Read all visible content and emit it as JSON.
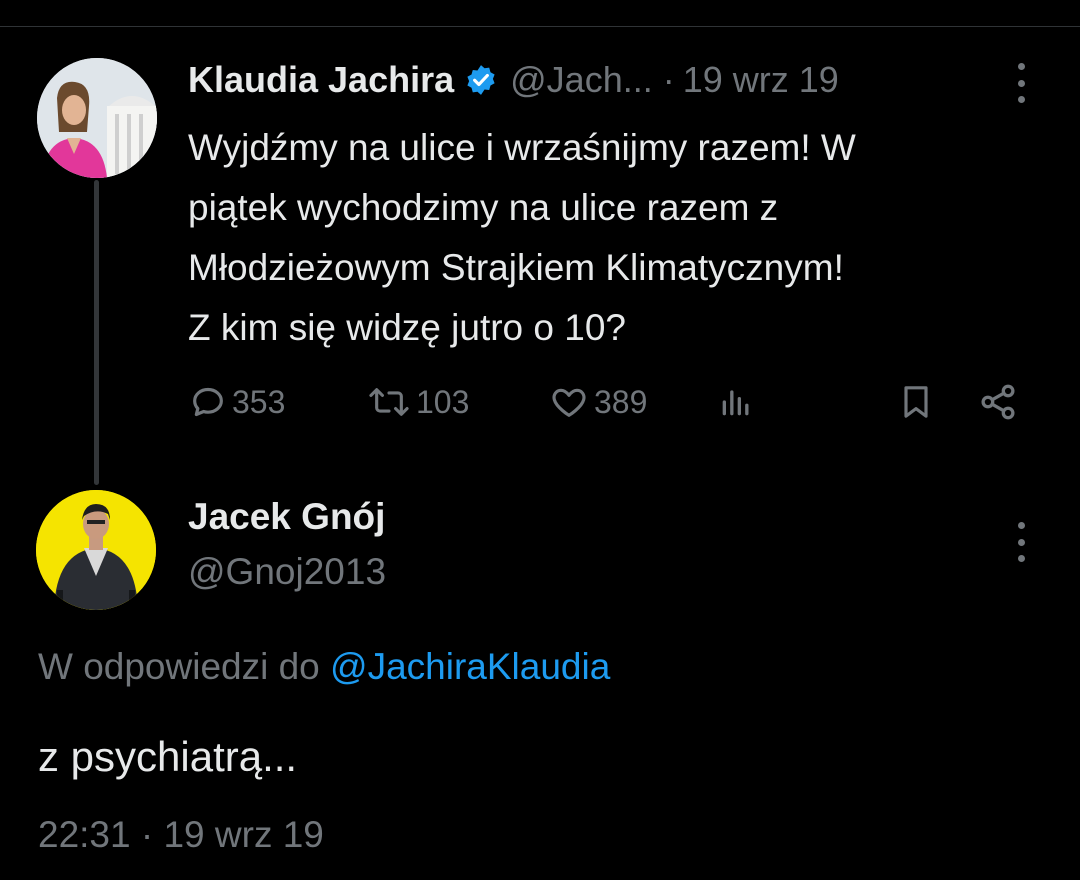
{
  "parent_tweet": {
    "author_name": "Klaudia Jachira",
    "author_handle": "@Jach...",
    "separator": "·",
    "date": "19 wrz 19",
    "text": "Wyjdźmy na ulice i wrzaśnijmy razem! W\npiątek wychodzimy na ulice razem z\nMłodzieżowym Strajkiem Klimatycznym!\nZ kim się widzę jutro o 10?",
    "icons": [
      "verified-badge-icon",
      "more-icon",
      "reply-icon",
      "retweet-icon",
      "like-icon",
      "views-icon",
      "bookmark-icon",
      "share-icon"
    ],
    "stats": {
      "replies": "353",
      "retweets": "103",
      "likes": "389"
    }
  },
  "reply_tweet": {
    "author_name": "Jacek Gnój",
    "author_handle": "@Gnoj2013",
    "reply_prefix": "W odpowiedzi do",
    "reply_mention": "@JachiraKlaudia",
    "text": "z psychiatrą...",
    "timestamp": "22:31 · 19 wrz 19"
  },
  "colors": {
    "background": "#000000",
    "text_primary": "#e7e9ea",
    "text_secondary": "#71767b",
    "link": "#1d9bf0",
    "verified": "#1d9bf0",
    "reply_avatar_bg": "#f5e400"
  }
}
